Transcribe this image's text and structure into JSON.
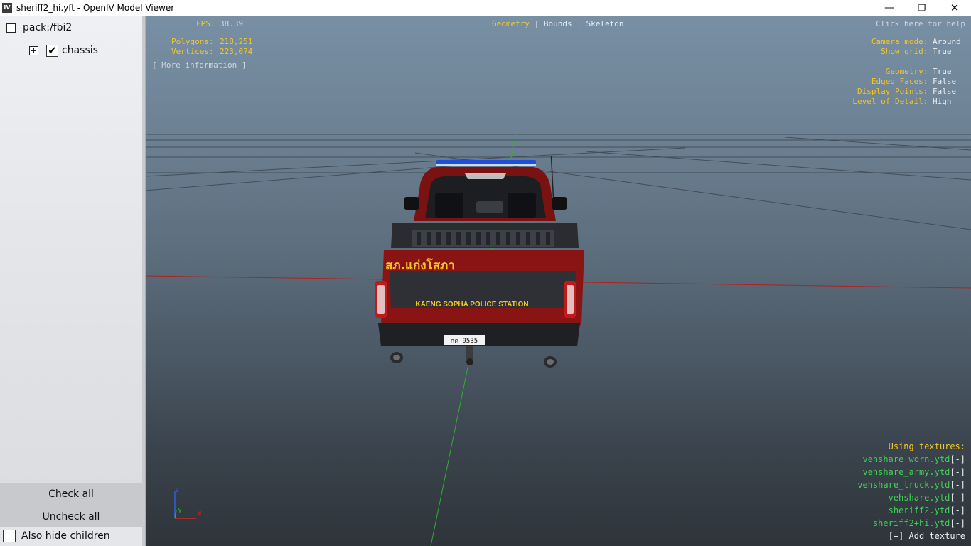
{
  "window": {
    "title": "sheriff2_hi.yft - OpenIV Model Viewer",
    "icon_text": "IV",
    "controls": {
      "minimize": "—",
      "maximize": "❐",
      "close": "✕"
    }
  },
  "tree": {
    "root": {
      "label": "pack:/fbi2",
      "expanded": true
    },
    "children": [
      {
        "label": "chassis",
        "checked": true,
        "expanded": false
      }
    ]
  },
  "left_buttons": {
    "check_all": "Check all",
    "uncheck_all": "Uncheck all",
    "also_hide_children": "Also hide children"
  },
  "viewport": {
    "fps_label": "FPS:",
    "fps_value": "38.39",
    "polygons_label": "Polygons:",
    "polygons_value": "218,251",
    "vertices_label": "Vertices:",
    "vertices_value": "223,074",
    "more_info": "[ More information ]",
    "view_tabs": {
      "geometry": "Geometry",
      "bounds": "Bounds",
      "skeleton": "Skeleton",
      "separator": "|"
    },
    "help": "Click here for help",
    "settings": [
      {
        "label": "Camera mode:",
        "value": "Around"
      },
      {
        "label": "Show grid:",
        "value": "True"
      },
      {
        "label": "Geometry:",
        "value": "True"
      },
      {
        "label": "Edged Faces:",
        "value": "False"
      },
      {
        "label": "Display Points:",
        "value": "False"
      },
      {
        "label": "Level of Detail:",
        "value": "High"
      }
    ],
    "textures_header": "Using textures:",
    "textures": [
      {
        "name": "vehshare_worn.ytd",
        "remove": "[-]"
      },
      {
        "name": "vehshare_army.ytd",
        "remove": "[-]"
      },
      {
        "name": "vehshare_truck.ytd",
        "remove": "[-]"
      },
      {
        "name": "vehshare.ytd",
        "remove": "[-]"
      },
      {
        "name": "sheriff2.ytd",
        "remove": "[-]"
      },
      {
        "name": "sheriff2+hi.ytd",
        "remove": "[-]"
      }
    ],
    "add_texture": "[+] Add texture",
    "axis": {
      "z": "z",
      "y": "y",
      "x": "x"
    }
  },
  "vehicle": {
    "thai_text": "สภ.แก่งโสภา",
    "station_text": "KAENG SOPHA POLICE STATION",
    "plate_text": "กด 9535",
    "body_color": "#8a1414",
    "lightbar_color": "#1f4fd8"
  },
  "colors": {
    "hud_yellow": "#f3c62a",
    "hud_white": "#e9edf0",
    "texture_green": "#3fcf55"
  }
}
